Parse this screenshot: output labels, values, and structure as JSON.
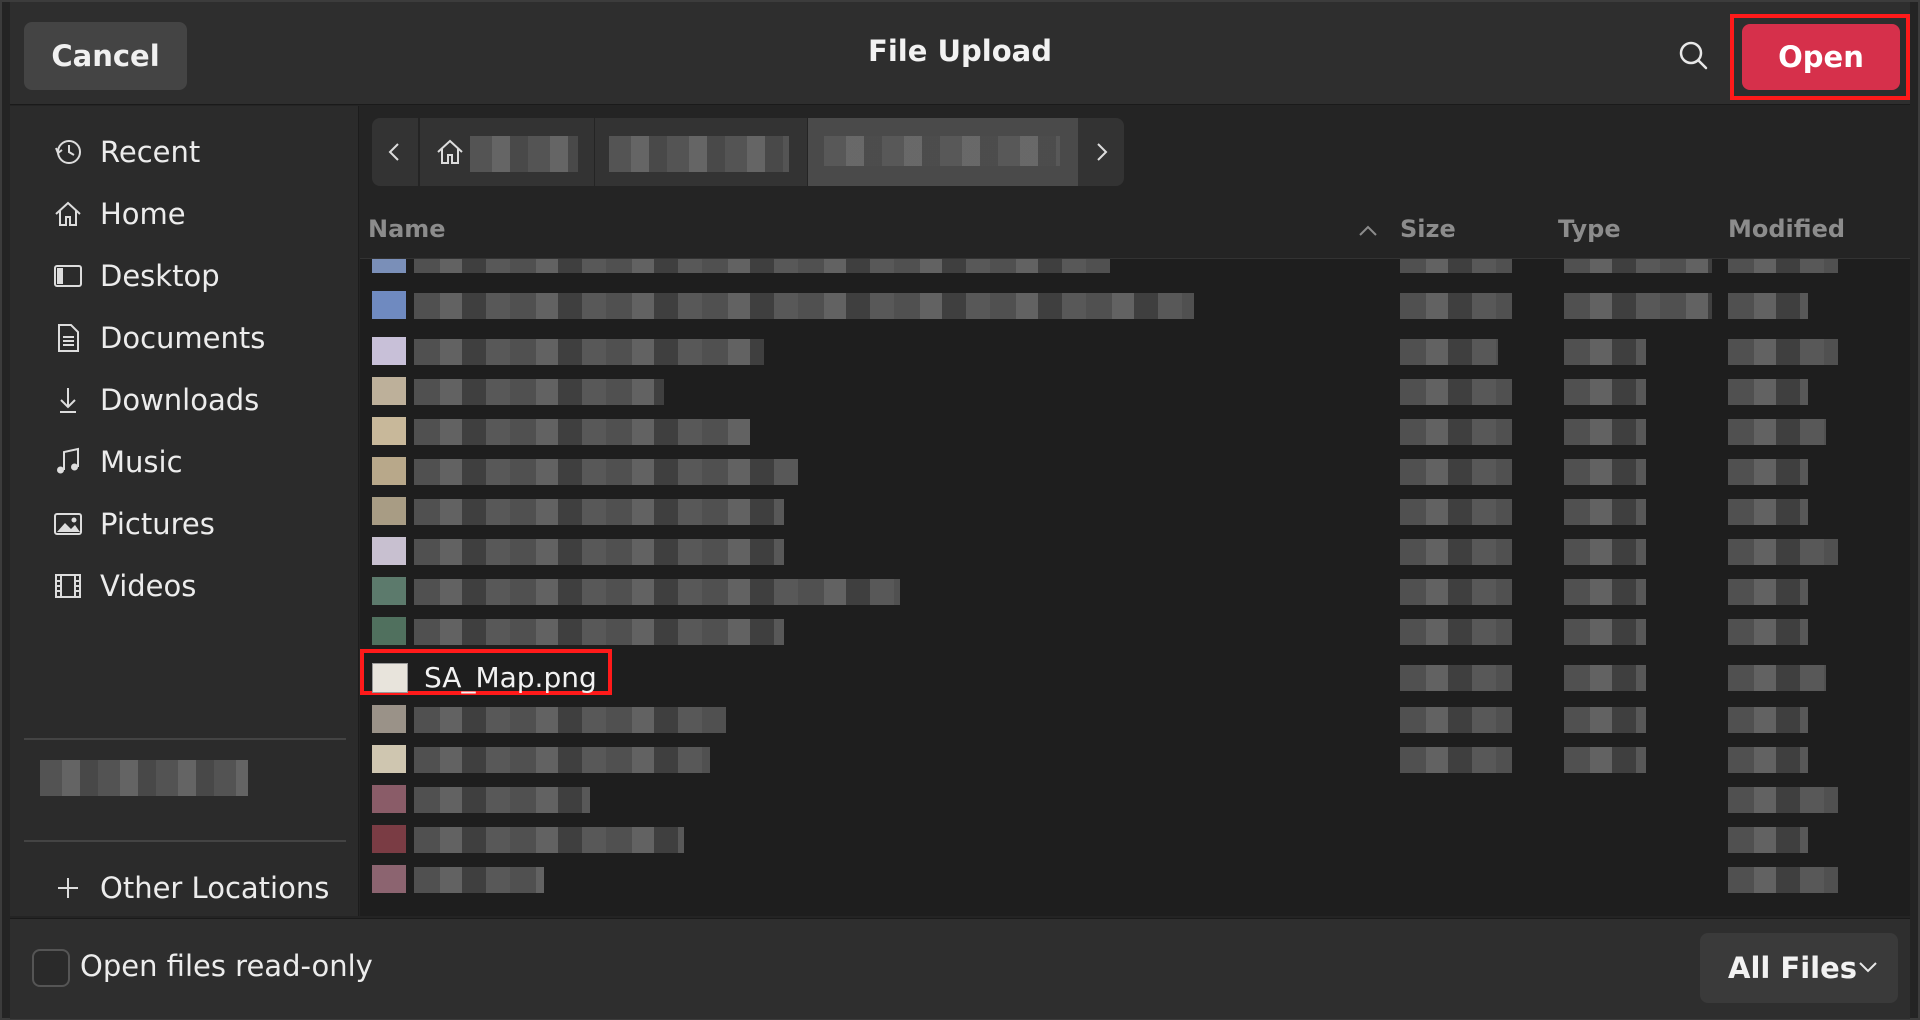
{
  "titlebar": {
    "cancel_label": "Cancel",
    "title": "File Upload",
    "open_label": "Open",
    "badge": "1"
  },
  "sidebar": {
    "items": [
      {
        "label": "Recent",
        "icon": "clock-icon"
      },
      {
        "label": "Home",
        "icon": "home-icon"
      },
      {
        "label": "Desktop",
        "icon": "desktop-icon"
      },
      {
        "label": "Documents",
        "icon": "document-icon"
      },
      {
        "label": "Downloads",
        "icon": "download-icon"
      },
      {
        "label": "Music",
        "icon": "music-icon"
      },
      {
        "label": "Pictures",
        "icon": "picture-icon"
      },
      {
        "label": "Videos",
        "icon": "video-icon"
      }
    ],
    "other_locations": "Other Locations"
  },
  "columns": {
    "name": "Name",
    "size": "Size",
    "type": "Type",
    "modified": "Modified"
  },
  "files": {
    "selected_name": "SA_Map.png"
  },
  "footer": {
    "readonly_label": "Open files read-only",
    "filter_label": "All Files"
  },
  "colors": {
    "accent": "#d6304b",
    "highlight": "#ff1a1a"
  }
}
